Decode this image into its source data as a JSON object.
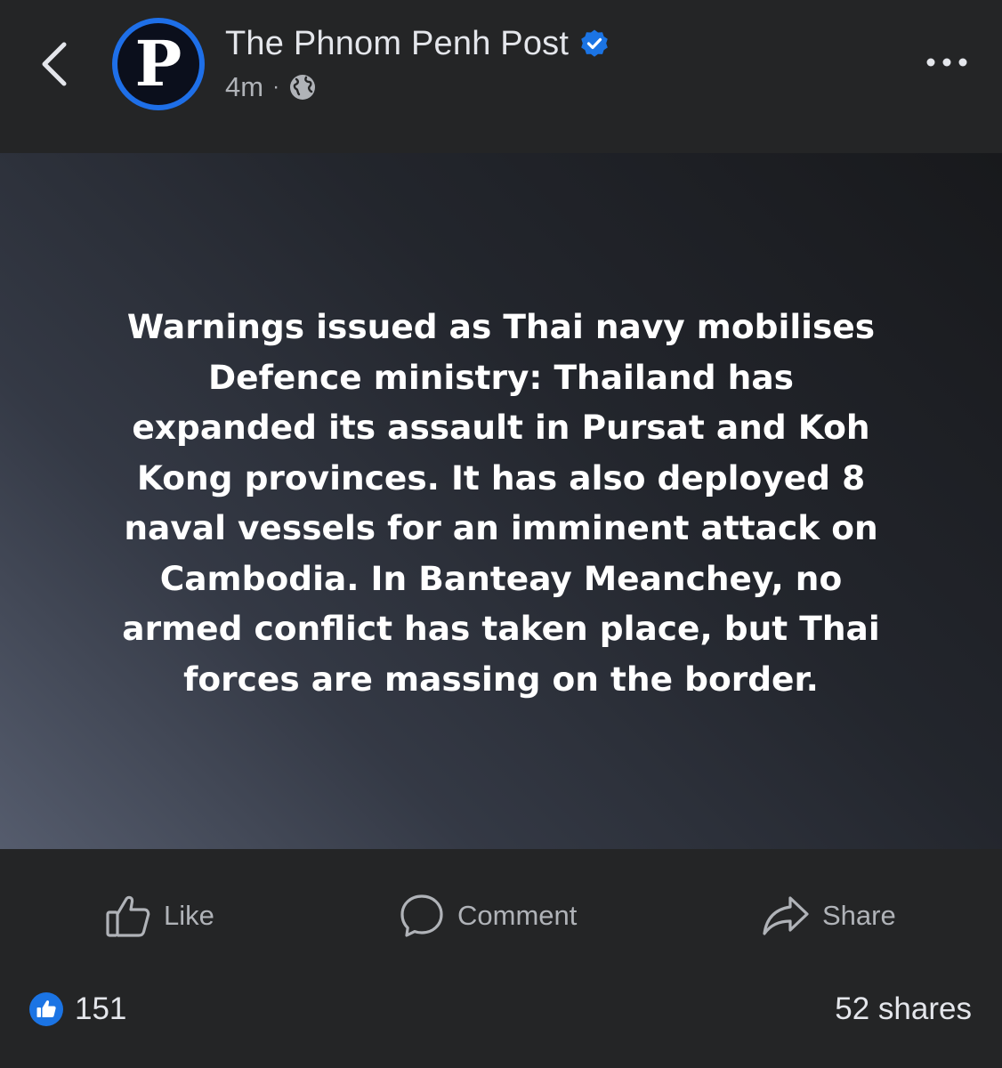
{
  "post": {
    "page_name": "The Phnom Penh Post",
    "time": "4m",
    "separator": "·",
    "audience_icon": "globe-icon",
    "verified_icon": "verified-badge-icon",
    "avatar_letter": "P",
    "text": "Warnings issued as Thai navy mobilises\nDefence ministry: Thailand has\nexpanded its assault in Pursat and Koh\nKong provinces. It has also deployed 8\nnaval vessels for an imminent attack on\nCambodia. In Banteay Meanchey, no\narmed conflict has taken place, but Thai\nforces are massing on the border."
  },
  "actions": {
    "like_label": "Like",
    "comment_label": "Comment",
    "share_label": "Share"
  },
  "stats": {
    "reactions": "151",
    "shares": "52 shares"
  },
  "colors": {
    "background": "#242526",
    "accent_blue": "#1b74e4",
    "secondary_text": "#b0b3b8"
  }
}
